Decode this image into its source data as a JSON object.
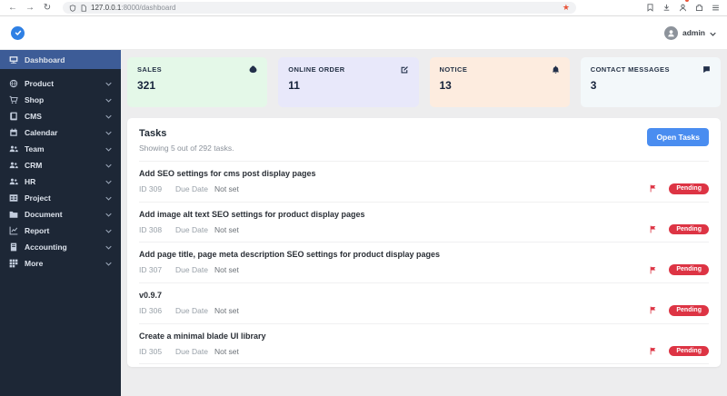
{
  "browser": {
    "url_host": "127.0.0.1",
    "url_rest": ":8000/dashboard",
    "back": "←",
    "forward": "→",
    "reload": "↻",
    "bookmark_star": "★"
  },
  "header": {
    "user_label": "admin"
  },
  "sidebar": {
    "active": {
      "label": "Dashboard"
    },
    "items": [
      {
        "label": "Product"
      },
      {
        "label": "Shop"
      },
      {
        "label": "CMS"
      },
      {
        "label": "Calendar"
      },
      {
        "label": "Team"
      },
      {
        "label": "CRM"
      },
      {
        "label": "HR"
      },
      {
        "label": "Project"
      },
      {
        "label": "Document"
      },
      {
        "label": "Report"
      },
      {
        "label": "Accounting"
      },
      {
        "label": "More"
      }
    ]
  },
  "cards": [
    {
      "label": "SALES",
      "value": "321",
      "icon": "money-bag-icon",
      "bg": "#e4f8e8"
    },
    {
      "label": "ONLINE ORDER",
      "value": "11",
      "icon": "edit-square-icon",
      "bg": "#e8e8fa"
    },
    {
      "label": "NOTICE",
      "value": "13",
      "icon": "bell-icon",
      "bg": "#fdecdf"
    },
    {
      "label": "CONTACT MESSAGES",
      "value": "3",
      "icon": "chat-bubble-icon",
      "bg": "#f3f8fa"
    }
  ],
  "tasks": {
    "title": "Tasks",
    "subtitle": "Showing 5 out of 292 tasks.",
    "open_button": "Open Tasks",
    "items": [
      {
        "title": "Add SEO settings for cms post display pages",
        "id": "ID 309",
        "due_label": "Due Date",
        "due_value": "Not set",
        "status": "Pending"
      },
      {
        "title": "Add image alt text SEO settings for product display pages",
        "id": "ID 308",
        "due_label": "Due Date",
        "due_value": "Not set",
        "status": "Pending"
      },
      {
        "title": "Add page title, page meta description SEO settings for product display pages",
        "id": "ID 307",
        "due_label": "Due Date",
        "due_value": "Not set",
        "status": "Pending"
      },
      {
        "title": "v0.9.7",
        "id": "ID 306",
        "due_label": "Due Date",
        "due_value": "Not set",
        "status": "Pending"
      },
      {
        "title": "Create a minimal blade UI library",
        "id": "ID 305",
        "due_label": "Due Date",
        "due_value": "Not set",
        "status": "Pending"
      }
    ]
  },
  "colors": {
    "sidebar_bg": "#1d2736",
    "sidebar_active_bg": "#3d5c97",
    "logo_blue": "#2f80e4",
    "open_tasks_button_bg": "#4a8df0",
    "pending_badge_bg": "#dd3444",
    "flag_red": "#dd3444",
    "bookmark_star_color": "#e8553a",
    "main_bg": "#ededee"
  },
  "icons": [
    "back-icon",
    "forward-icon",
    "reload-icon",
    "shield-icon",
    "page-icon",
    "bookmark-star-icon",
    "save-icon",
    "download-icon",
    "account-icon",
    "extension-icon",
    "menu-icon",
    "check-logo-icon",
    "avatar-person-icon",
    "chevron-down-icon",
    "monitor-icon",
    "globe-icon",
    "cart-icon",
    "book-icon",
    "calendar-icon",
    "users-icon",
    "table-icon",
    "folder-icon",
    "chart-icon",
    "ledger-icon",
    "grid-icon",
    "money-bag-icon",
    "edit-square-icon",
    "bell-icon",
    "chat-bubble-icon",
    "flag-icon"
  ]
}
